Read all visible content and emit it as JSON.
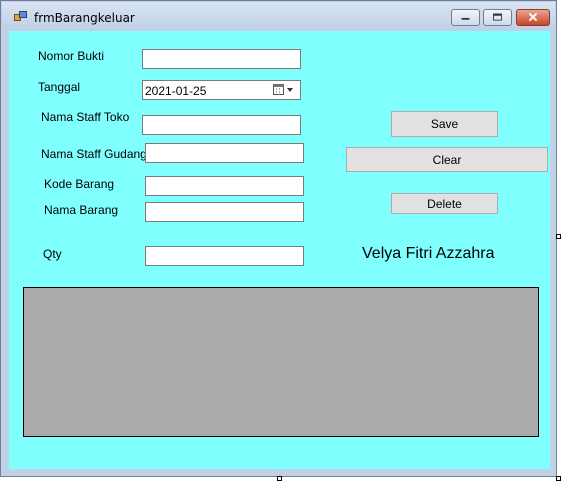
{
  "window": {
    "title": "frmBarangkeluar",
    "icon": "form-icon",
    "controls": {
      "minimize": "minimize-icon",
      "maximize": "maximize-icon",
      "close": "close-icon"
    }
  },
  "form": {
    "nomor_bukti": {
      "label": "Nomor Bukti",
      "value": ""
    },
    "tanggal": {
      "label": "Tanggal",
      "value": "2021-01-25",
      "icon": "calendar-icon"
    },
    "nama_staff_toko": {
      "label": "Nama Staff Toko",
      "value": ""
    },
    "nama_staff_gudang": {
      "label": "Nama Staff Gudang",
      "value": ""
    },
    "kode_barang": {
      "label": "Kode Barang",
      "value": ""
    },
    "nama_barang": {
      "label": "Nama Barang",
      "value": ""
    },
    "qty": {
      "label": "Qty",
      "value": ""
    }
  },
  "buttons": {
    "save": "Save",
    "clear": "Clear",
    "delete": "Delete"
  },
  "name_label": "Velya Fitri Azzahra",
  "colors": {
    "form_background": "#80ffff",
    "grid_background": "#ababab",
    "titlebar": "#c9d7ec",
    "button": "#e1e1e1"
  }
}
